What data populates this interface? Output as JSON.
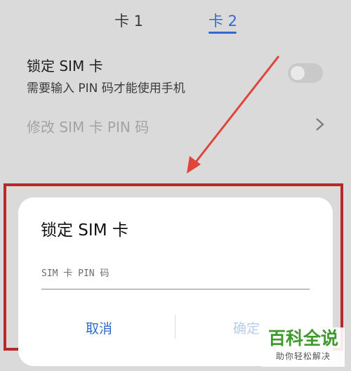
{
  "tabs": [
    {
      "label": "卡 1",
      "selected": false
    },
    {
      "label": "卡 2",
      "selected": true
    }
  ],
  "lock_sim": {
    "title": "锁定 SIM 卡",
    "subtitle": "需要输入 PIN 码才能使用手机",
    "toggle_on": false
  },
  "change_pin": {
    "label": "修改 SIM 卡 PIN 码",
    "icon": "chevron-right-icon"
  },
  "dialog": {
    "title": "锁定 SIM 卡",
    "pin_placeholder": "SIM 卡 PIN 码",
    "cancel_label": "取消",
    "confirm_label": "确定"
  },
  "watermark": {
    "main": "百科全说",
    "sub": "助你轻松解决"
  },
  "colors": {
    "accent": "#2f6bcc",
    "highlight": "#b8282c",
    "background": "#dadada"
  }
}
